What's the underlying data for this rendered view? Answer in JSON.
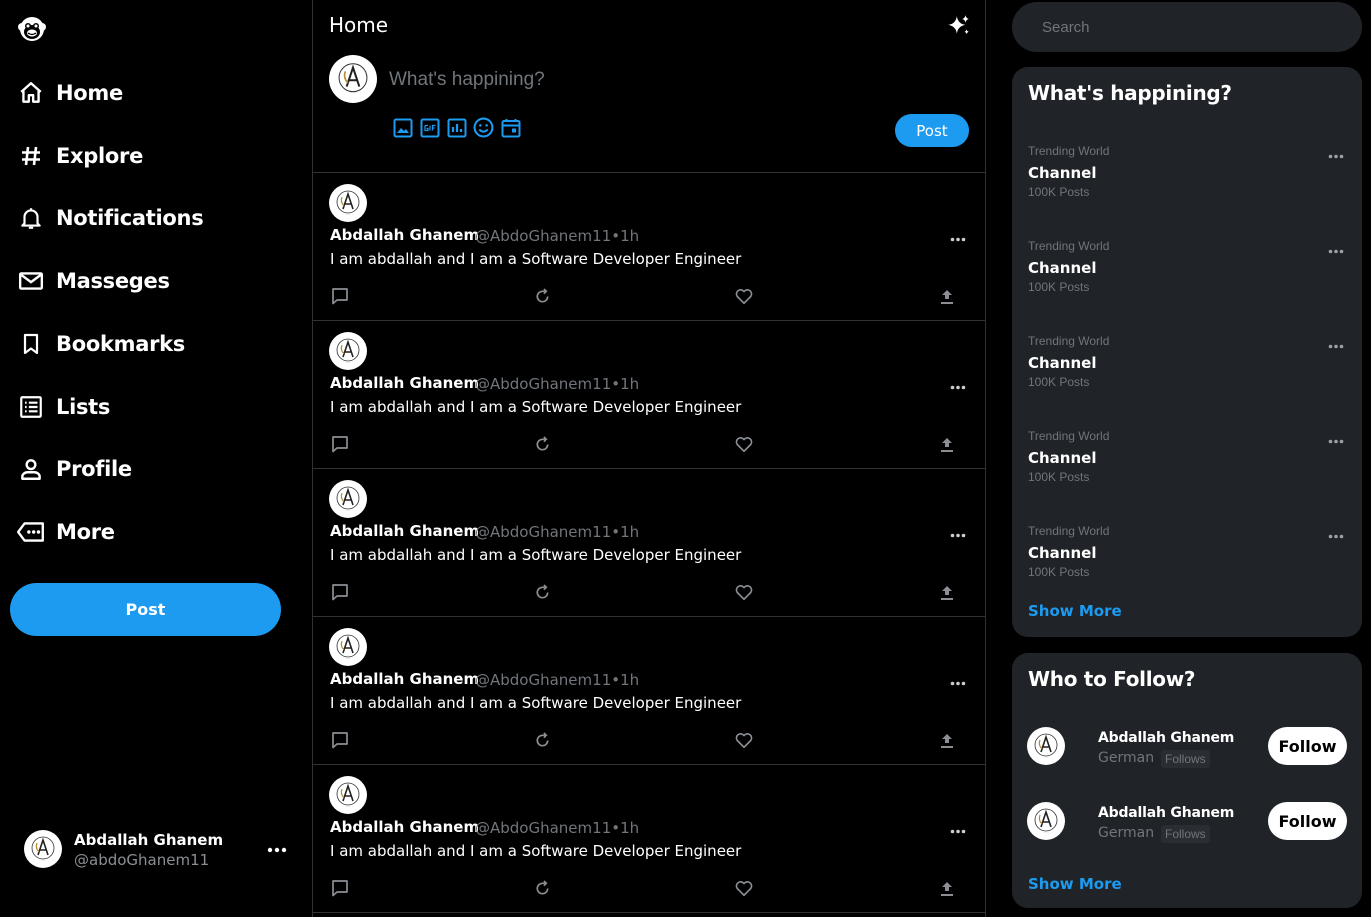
{
  "brand": {
    "accent": "#1d9bf0",
    "logo_icon": "monkey-logo-icon"
  },
  "nav": {
    "items": [
      {
        "label": "Home",
        "icon": "home-icon"
      },
      {
        "label": "Explore",
        "icon": "hashtag-icon"
      },
      {
        "label": "Notifications",
        "icon": "bell-icon"
      },
      {
        "label": "Masseges",
        "icon": "mail-icon"
      },
      {
        "label": "Bookmarks",
        "icon": "bookmark-icon"
      },
      {
        "label": "Lists",
        "icon": "list-icon"
      },
      {
        "label": "Profile",
        "icon": "person-icon"
      },
      {
        "label": "More",
        "icon": "more-circle-icon"
      }
    ],
    "post_label": "Post"
  },
  "current_user": {
    "name": "Abdallah Ghanem",
    "handle": "@abdoGhanem11"
  },
  "feed": {
    "title": "Home",
    "compose": {
      "placeholder": "What's happining?",
      "post_label": "Post"
    },
    "tweets": [
      {
        "author": "Abdallah Ghanem",
        "handle": "@AbdoGhanem11•1h",
        "text": "I am abdallah and I am a Software Developer Engineer"
      },
      {
        "author": "Abdallah Ghanem",
        "handle": "@AbdoGhanem11•1h",
        "text": "I am abdallah and I am a Software Developer Engineer"
      },
      {
        "author": "Abdallah Ghanem",
        "handle": "@AbdoGhanem11•1h",
        "text": "I am abdallah and I am a Software Developer Engineer"
      },
      {
        "author": "Abdallah Ghanem",
        "handle": "@AbdoGhanem11•1h",
        "text": "I am abdallah and I am a Software Developer Engineer"
      },
      {
        "author": "Abdallah Ghanem",
        "handle": "@AbdoGhanem11•1h",
        "text": "I am abdallah and I am a Software Developer Engineer"
      }
    ]
  },
  "search": {
    "placeholder": "Search"
  },
  "trends": {
    "title": "What's happining?",
    "items": [
      {
        "meta": "Trending World",
        "name": "Channel",
        "count": "100K Posts"
      },
      {
        "meta": "Trending World",
        "name": "Channel",
        "count": "100K Posts"
      },
      {
        "meta": "Trending World",
        "name": "Channel",
        "count": "100K Posts"
      },
      {
        "meta": "Trending World",
        "name": "Channel",
        "count": "100K Posts"
      },
      {
        "meta": "Trending World",
        "name": "Channel",
        "count": "100K Posts"
      }
    ],
    "show_more": "Show More"
  },
  "who_to_follow": {
    "title": "Who to Follow?",
    "items": [
      {
        "name": "Abdallah Ghanem",
        "subtitle": "German",
        "badge": "Follows",
        "button": "Follow"
      },
      {
        "name": "Abdallah Ghanem",
        "subtitle": "German",
        "badge": "Follows",
        "button": "Follow"
      }
    ],
    "show_more": "Show More"
  }
}
